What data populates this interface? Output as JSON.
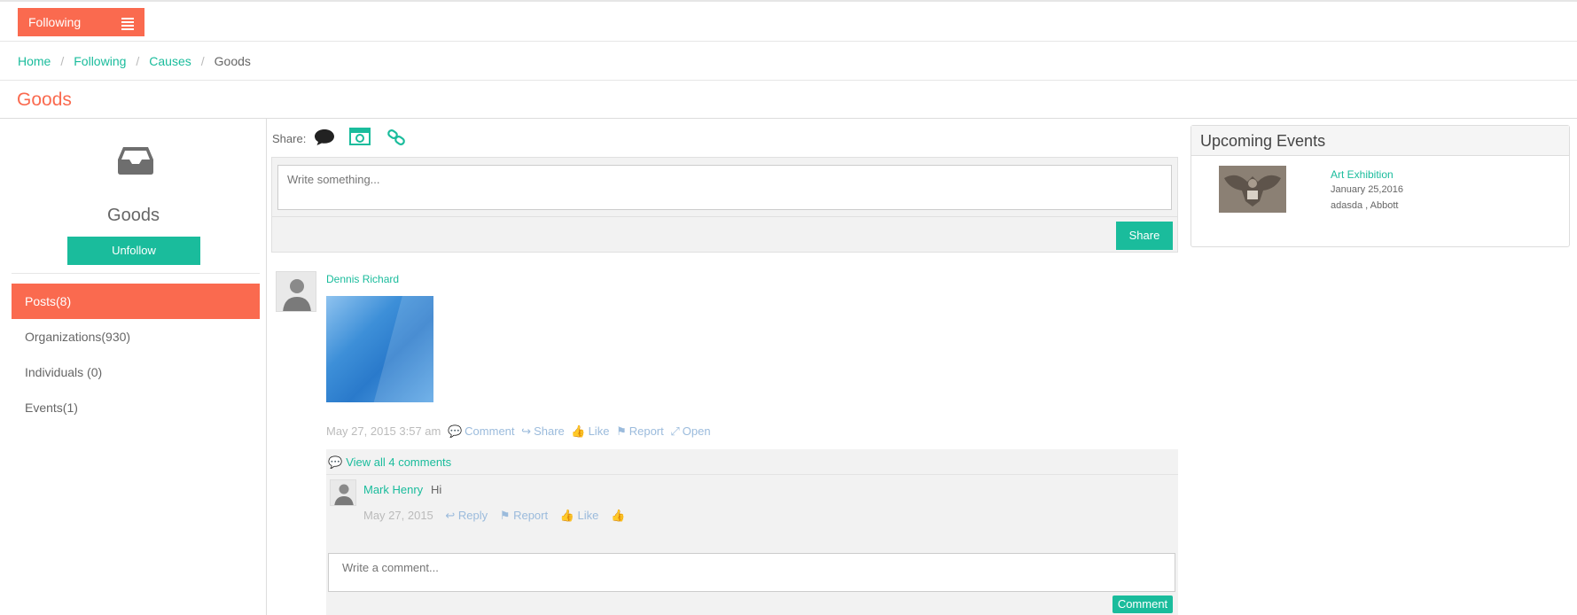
{
  "topbar": {
    "following_label": "Following"
  },
  "breadcrumb": {
    "items": [
      "Home",
      "Following",
      "Causes"
    ],
    "current": "Goods",
    "separator": "/"
  },
  "page_title": "Goods",
  "cause": {
    "name": "Goods",
    "unfollow_label": "Unfollow",
    "nav": [
      "Posts(8)",
      "Organizations(930)",
      "Individuals (0)",
      "Events(1)"
    ],
    "active_nav": "Posts(8)"
  },
  "composer": {
    "share_label": "Share:",
    "placeholder": "Write something...",
    "share_button": "Share",
    "icons": [
      "chat-bubble-icon",
      "photo-camera-icon",
      "link-icon"
    ]
  },
  "post": {
    "author": "Dennis Richard",
    "timestamp": "May 27, 2015 3:57 am",
    "actions": [
      "Comment",
      "Share",
      "Like",
      "Report",
      "Open"
    ],
    "view_all_comments": "View all 4 comments",
    "comment": {
      "author": "Mark Henry",
      "text": "Hi",
      "date": "May 27, 2015",
      "actions": [
        "Reply",
        "Report",
        "Like"
      ]
    },
    "comment_placeholder": "Write a comment...",
    "comment_button": "Comment"
  },
  "events": {
    "heading": "Upcoming Events",
    "items": [
      {
        "title": "Art Exhibition",
        "date": "January 25,2016",
        "place": "adasda , Abbott"
      }
    ]
  },
  "colors": {
    "accent": "#fa6a4f",
    "brand": "#1abc9c",
    "muted_action": "#9bbbdc"
  }
}
